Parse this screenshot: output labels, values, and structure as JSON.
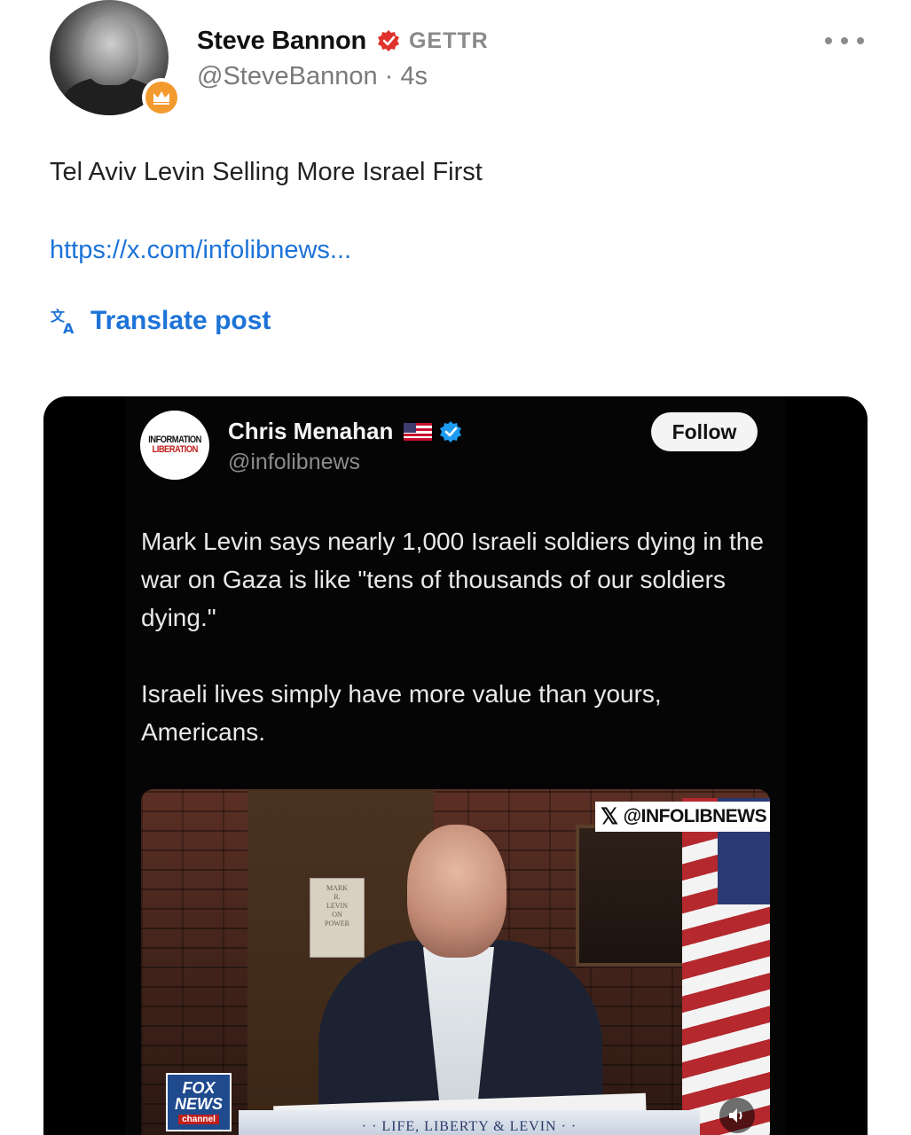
{
  "author": {
    "name": "Steve Bannon",
    "platform_tag": "GETTR",
    "handle": "@SteveBannon",
    "time": "4s"
  },
  "post": {
    "text": "Tel Aviv Levin Selling More Israel First",
    "link": "https://x.com/infolibnews...",
    "translate_label": "Translate post"
  },
  "embed": {
    "logo_line1": "INFORMATION",
    "logo_line2": "LIBERATION",
    "name": "Chris Menahan",
    "handle": "@infolibnews",
    "follow_label": "Follow",
    "body_p1": "Mark Levin says nearly 1,000 Israeli soldiers dying in the war on Gaza is like \"tens of thousands of our soldiers dying.\"",
    "body_p2": "Israeli lives simply have more value than yours, Americans.",
    "video": {
      "watermark": "@INFOLIBNEWS",
      "network_line1": "FOX",
      "network_line2": "NEWS",
      "network_line3": "channel",
      "show_title": "· · LIFE, LIBERTY & LEVIN · ·",
      "book_text": [
        "MARK",
        "R.",
        "LEVIN",
        "ON",
        "POWER"
      ]
    }
  },
  "colors": {
    "link": "#1d73d8",
    "verified_red": "#e0322b",
    "verified_blue": "#1d9bf0",
    "badge_orange": "#f29a2e"
  }
}
